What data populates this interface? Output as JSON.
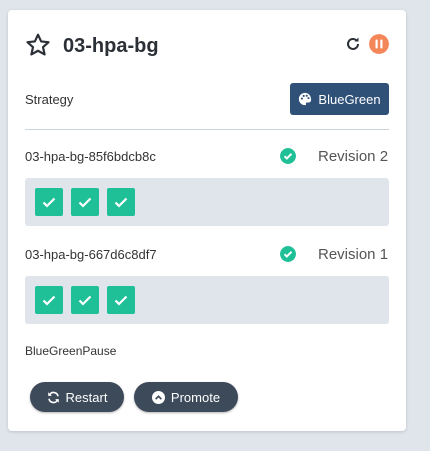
{
  "colors": {
    "star": "#2b2f36",
    "pause": "#f4875a",
    "strategy_badge": "#2f5178",
    "healthy": "#1fbf97",
    "button": "#3c4a5a"
  },
  "card": {
    "title": "03-hpa-bg",
    "star_icon": "star-outline-icon",
    "refresh_icon": "refresh-icon",
    "pause_icon": "pause-circle-icon"
  },
  "strategy": {
    "label": "Strategy",
    "badge_label": "BlueGreen",
    "badge_icon": "palette-icon"
  },
  "replica_sets": [
    {
      "name": "03-hpa-bg-85f6bdcb8c",
      "revision": "Revision 2",
      "status": "healthy",
      "pods": [
        "healthy",
        "healthy",
        "healthy"
      ]
    },
    {
      "name": "03-hpa-bg-667d6c8df7",
      "revision": "Revision 1",
      "status": "healthy",
      "pods": [
        "healthy",
        "healthy",
        "healthy"
      ]
    }
  ],
  "step_label": "BlueGreenPause",
  "actions": {
    "restart_label": "Restart",
    "promote_label": "Promote"
  }
}
